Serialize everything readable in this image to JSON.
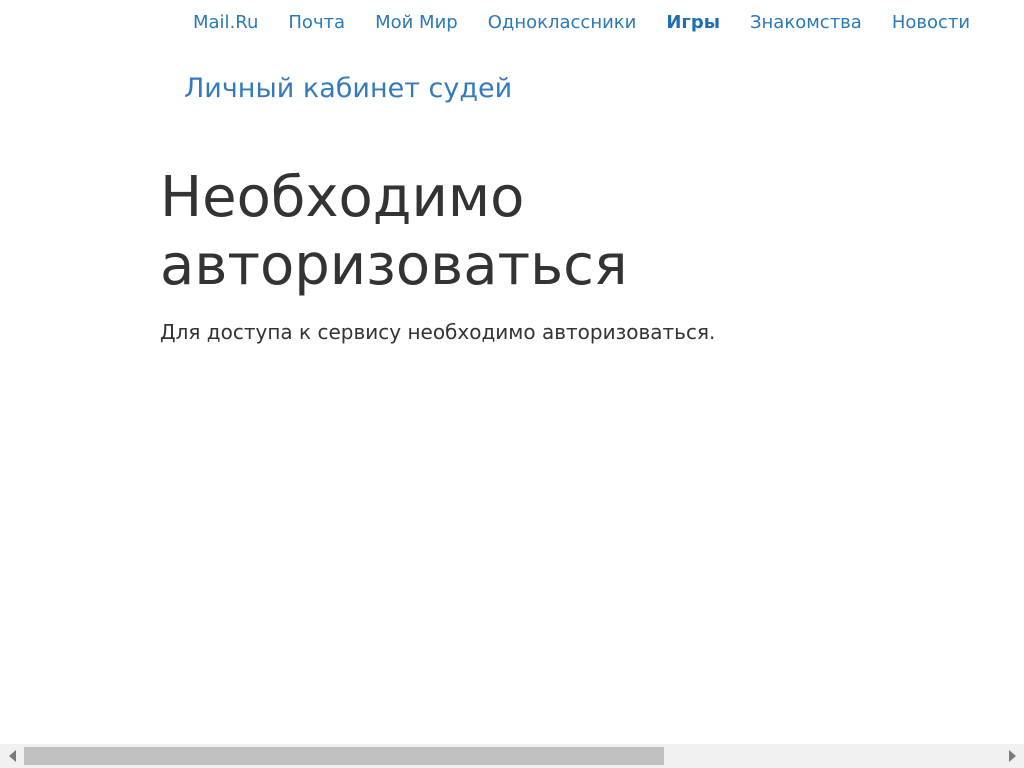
{
  "portal_nav": {
    "items": [
      {
        "label": "Mail.Ru",
        "active": false
      },
      {
        "label": "Почта",
        "active": false
      },
      {
        "label": "Мой Мир",
        "active": false
      },
      {
        "label": "Одноклассники",
        "active": false
      },
      {
        "label": "Игры",
        "active": true
      },
      {
        "label": "Знакомства",
        "active": false
      },
      {
        "label": "Новости",
        "active": false
      }
    ]
  },
  "header": {
    "brand_link": "Личный кабинет судей"
  },
  "main": {
    "title": "Необходимо авторизоваться",
    "message": "Для доступа к сервису необходимо авторизоваться."
  },
  "colors": {
    "link": "#2a79b8",
    "link_active": "#1d6fb3",
    "text": "#333333",
    "scrollbar_track": "#f1f1f1",
    "scrollbar_thumb": "#c1c1c1"
  },
  "scrollbar": {
    "icons": [
      "arrow-left-icon",
      "arrow-right-icon"
    ]
  }
}
